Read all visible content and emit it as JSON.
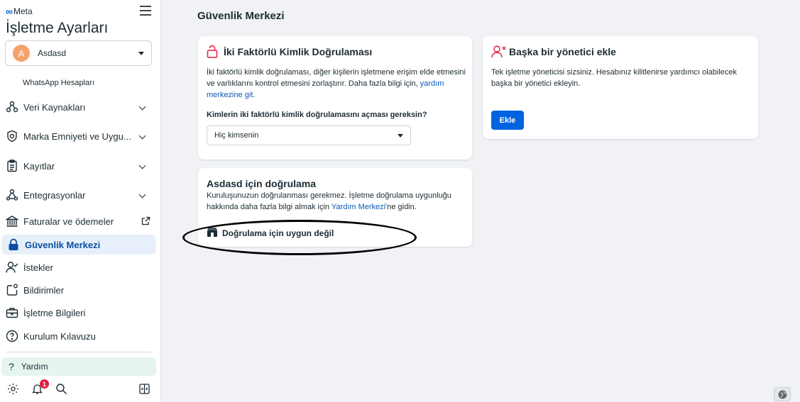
{
  "brand": {
    "logo_text": "Meta"
  },
  "sidebar": {
    "title": "İşletme Ayarları",
    "account": {
      "initial": "A",
      "name": "Asdasd"
    },
    "sub_item": "WhatsApp Hesapları",
    "items": [
      {
        "label": "Veri Kaynakları",
        "icon": "data-sources-icon"
      },
      {
        "label": "Marka Emniyeti ve Uygu...",
        "icon": "shield-icon"
      },
      {
        "label": "Kayıtlar",
        "icon": "clipboard-icon"
      },
      {
        "label": "Entegrasyonlar",
        "icon": "integrations-icon"
      },
      {
        "label": "Faturalar ve ödemeler",
        "icon": "bank-icon"
      },
      {
        "label": "Güvenlik Merkezi",
        "icon": "lock-icon"
      },
      {
        "label": "İstekler",
        "icon": "requests-icon"
      },
      {
        "label": "Bildirimler",
        "icon": "notifications-icon"
      },
      {
        "label": "İşletme Bilgileri",
        "icon": "briefcase-icon"
      },
      {
        "label": "Kurulum Kılavuzu",
        "icon": "question-circle-icon"
      }
    ],
    "help_label": "Yardım",
    "notification_count": "1"
  },
  "main": {
    "title": "Güvenlik Merkezi",
    "two_factor": {
      "title": "İki Faktörlü Kimlik Doğrulaması",
      "body_line1": "İki faktörlü kimlik doğrulaması, diğer kişilerin işletmene erişim elde etmesini",
      "body_line2": "ve varlıklarını kontrol etmesini zorlaştırır. Daha fazla bilgi için, ",
      "link_text1": "yardım",
      "link_text2": "merkezine git",
      "body_end": ".",
      "question": "Kimlerin iki faktörlü kimlik doğrulamasını açması gereksin?",
      "select_value": "Hiç kimsenin"
    },
    "add_admin": {
      "title": "Başka bir yönetici ekle",
      "body_line1": "Tek işletme yöneticisi sizsiniz. Hesabınız kilitlenirse yardımcı olabilecek",
      "body_line2": "başka bir yönetici ekleyin.",
      "button_label": "Ekle"
    },
    "verification": {
      "title": "Asdasd için doğrulama",
      "body_line1": "Kuruluşunuzun doğrulanması gerekmez. İşletme doğrulama uygunluğu",
      "body_line2": "hakkında daha fazla bilgi almak için ",
      "link_text": "Yardım Merkezi",
      "body_end": "'ne gidin.",
      "status": "Doğrulama için uygun değil"
    }
  },
  "colors": {
    "accent": "#0064e0",
    "active_bg": "#e7f0fa",
    "help_bg": "#e6f4ee",
    "badge": "#e41e3f"
  }
}
